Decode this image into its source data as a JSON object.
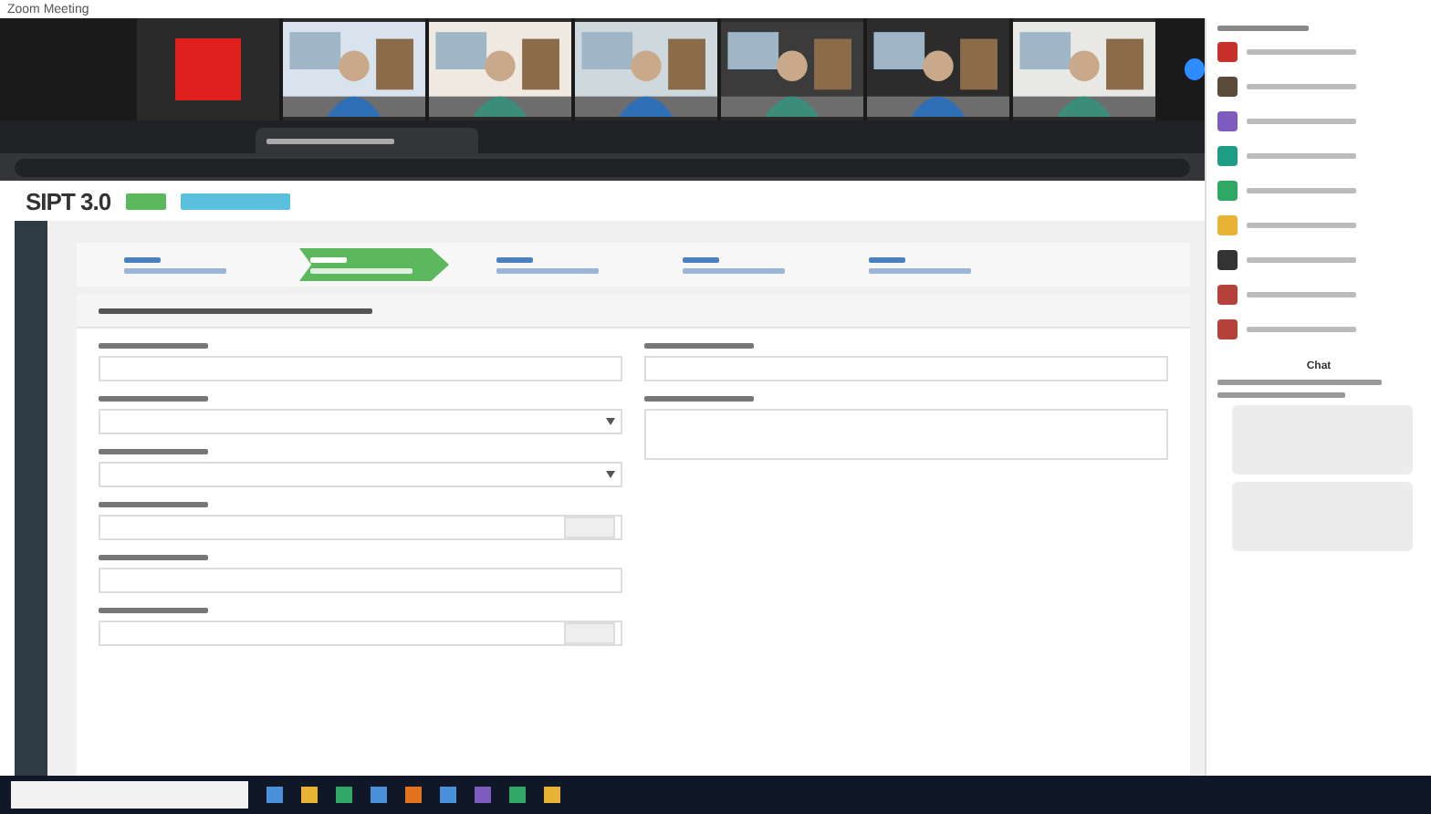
{
  "window": {
    "title": "Zoom Meeting"
  },
  "video_tiles": [
    {
      "kind": "logo",
      "color": "#e0201c"
    },
    {
      "kind": "picture"
    },
    {
      "kind": "picture"
    },
    {
      "kind": "picture"
    },
    {
      "kind": "picture"
    },
    {
      "kind": "picture"
    },
    {
      "kind": "picture"
    }
  ],
  "app": {
    "name": "SIPT 3.0"
  },
  "steps": [
    {
      "selected": false
    },
    {
      "selected": true
    },
    {
      "selected": false
    },
    {
      "selected": false
    },
    {
      "selected": false
    }
  ],
  "form": {
    "left_fields": [
      {
        "kind": "input"
      },
      {
        "kind": "select"
      },
      {
        "kind": "select"
      },
      {
        "kind": "button"
      },
      {
        "kind": "input"
      },
      {
        "kind": "button"
      }
    ],
    "right_fields": [
      {
        "kind": "input"
      },
      {
        "kind": "textarea"
      }
    ]
  },
  "participants": [
    {
      "color": "#c8302c"
    },
    {
      "color": "#5a4a3a"
    },
    {
      "color": "#7d5bbf"
    },
    {
      "color": "#1e9c84"
    },
    {
      "color": "#2fa866"
    },
    {
      "color": "#e8b234"
    },
    {
      "color": "#333333"
    },
    {
      "color": "#b5423a"
    },
    {
      "color": "#b5423a"
    }
  ],
  "chat": {
    "title": "Chat"
  }
}
